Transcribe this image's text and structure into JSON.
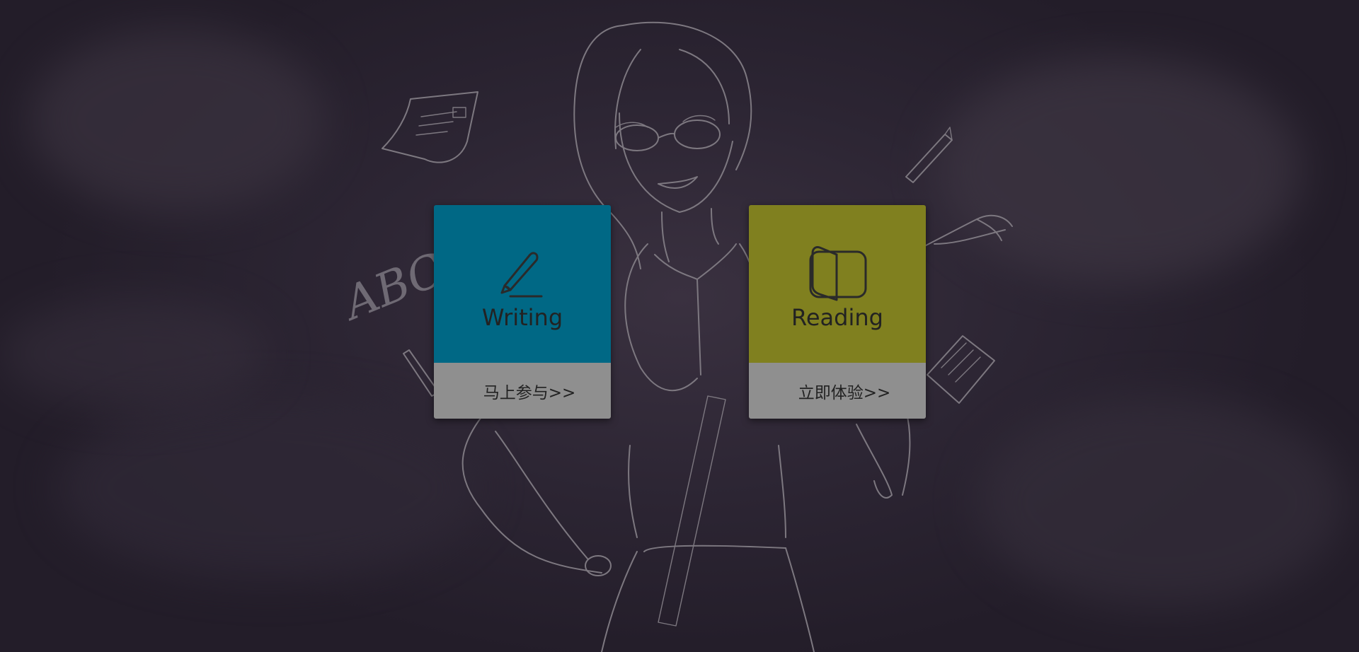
{
  "cards": [
    {
      "title": "Writing",
      "icon": "pen-icon",
      "action_label": "马上参与>>",
      "color": "#006885"
    },
    {
      "title": "Reading",
      "icon": "book-icon",
      "action_label": "立即体验>>",
      "color": "#80801f"
    }
  ],
  "background": {
    "doodle_text": "ABC",
    "base_color": "#2c2533",
    "sketch_color": "#7d7880"
  }
}
